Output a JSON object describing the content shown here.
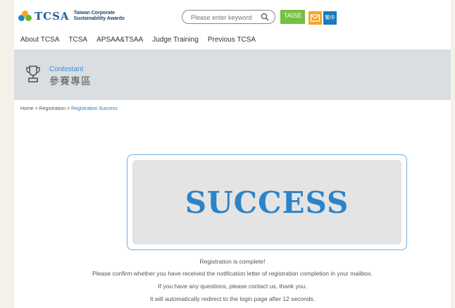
{
  "header": {
    "logo_text": "TCSA",
    "logo_sub_line1": "Taiwan Corporate",
    "logo_sub_line2": "Sustainability Awards",
    "search_placeholder": "Please enter keyword",
    "taise_label": "TAISE",
    "lang_label": "繁中"
  },
  "nav": {
    "items": [
      "About TCSA",
      "TCSA",
      "APSAA&TSAA",
      "Judge Training",
      "Previous TCSA"
    ]
  },
  "banner": {
    "title_en": "Contestant",
    "title_zh": "參賽專區"
  },
  "breadcrumb": {
    "home": "Home",
    "sep": " > ",
    "registration": "Registration",
    "current": "Registration Success"
  },
  "main": {
    "success_text": "SUCCESS",
    "messages": [
      "Registration is complete!",
      "Please confirm whether you have received the notification letter of registration completion in your mailbox.",
      "If you have any questions, please contact us, thank you.",
      "It will automatically redirect to the login page after 12 seconds."
    ]
  },
  "colors": {
    "accent_blue": "#2d83c7",
    "taise_green": "#75c043",
    "mail_orange": "#f5a623",
    "lang_blue": "#1a7bbf",
    "banner_bg": "#d9dee2"
  },
  "icons": [
    "search-icon",
    "mail-icon",
    "trophy-icon",
    "tcsa-logo-icon"
  ]
}
